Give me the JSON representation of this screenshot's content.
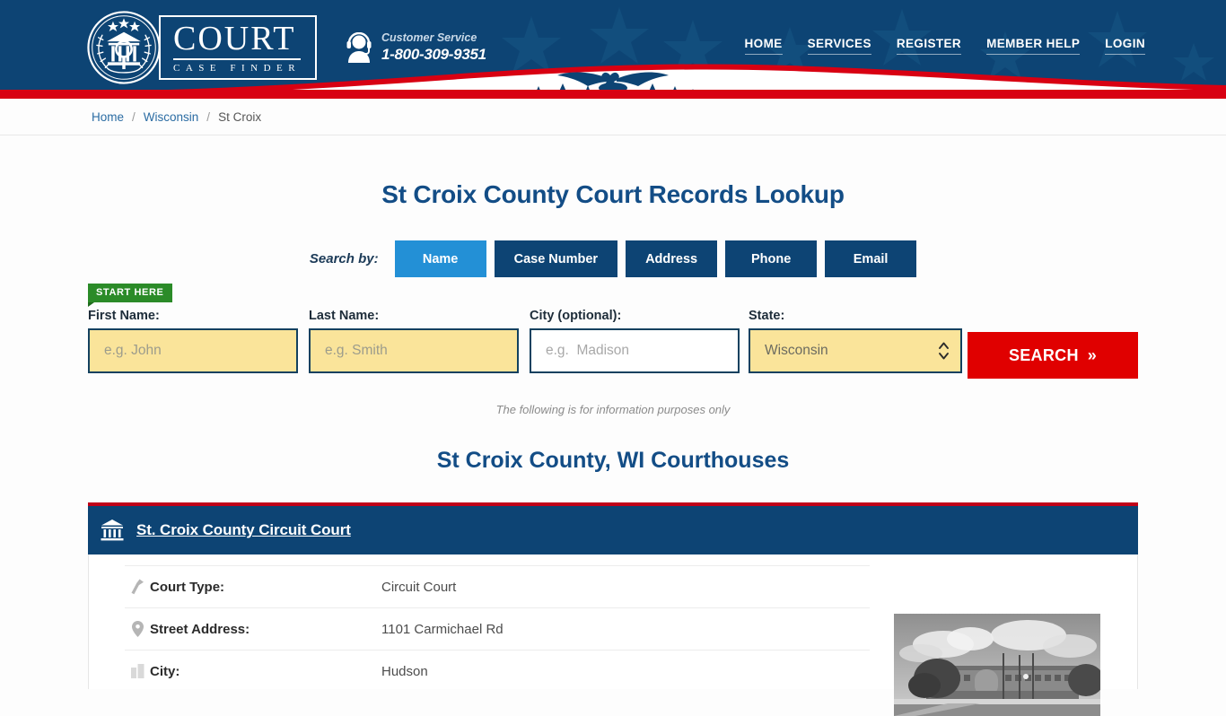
{
  "brand": {
    "name_line1": "COURT",
    "name_line2": "CASE FINDER",
    "seal_icon": "court-seal-icon"
  },
  "header": {
    "customer_service_label": "Customer Service",
    "phone": "1-800-309-9351",
    "support_icon": "headset-agent-icon",
    "nav": [
      {
        "label": "HOME",
        "name": "nav-home"
      },
      {
        "label": "SERVICES",
        "name": "nav-services"
      },
      {
        "label": "REGISTER",
        "name": "nav-register"
      },
      {
        "label": "MEMBER HELP",
        "name": "nav-member-help"
      },
      {
        "label": "LOGIN",
        "name": "nav-login"
      }
    ],
    "colors": {
      "navy": "#0d4474",
      "red": "#d80012",
      "white": "#ffffff"
    }
  },
  "breadcrumb": {
    "home": "Home",
    "sep1": "/",
    "state": "Wisconsin",
    "sep2": "/",
    "county": "St Croix"
  },
  "main": {
    "page_title": "St Croix County Court Records Lookup",
    "search_by_label": "Search by:",
    "tabs": [
      {
        "label": "Name",
        "active": true
      },
      {
        "label": "Case Number",
        "active": false
      },
      {
        "label": "Address",
        "active": false
      },
      {
        "label": "Phone",
        "active": false
      },
      {
        "label": "Email",
        "active": false
      }
    ],
    "start_here_badge": "START HERE",
    "fields": {
      "first_name": {
        "label": "First Name:",
        "value": "",
        "placeholder": "e.g. John"
      },
      "last_name": {
        "label": "Last Name:",
        "value": "",
        "placeholder": "e.g. Smith"
      },
      "city": {
        "label": "City (optional):",
        "value": "",
        "placeholder": "e.g.  Madison"
      },
      "state": {
        "label": "State:",
        "value": "Wisconsin"
      }
    },
    "search_button": "SEARCH",
    "search_button_chevron": "»",
    "disclaimer": "The following is for information purposes only",
    "section_title": "St Croix County, WI Courthouses"
  },
  "court": {
    "name": "St. Croix County Circuit Court",
    "icon": "courthouse-icon",
    "details": [
      {
        "icon": "gavel-icon",
        "label": "Court Type:",
        "value": "Circuit Court"
      },
      {
        "icon": "map-pin-icon",
        "label": "Street Address:",
        "value": "1101 Carmichael Rd"
      },
      {
        "icon": "city-icon",
        "label": "City:",
        "value": "Hudson"
      }
    ],
    "photo_alt": "courthouse-photo"
  },
  "colors": {
    "navy": "#0d4474",
    "accent_blue": "#2390d6",
    "heading_blue": "#134d86",
    "red": "#e00000",
    "green": "#2b8b28",
    "field_yellow": "#fae49a"
  }
}
